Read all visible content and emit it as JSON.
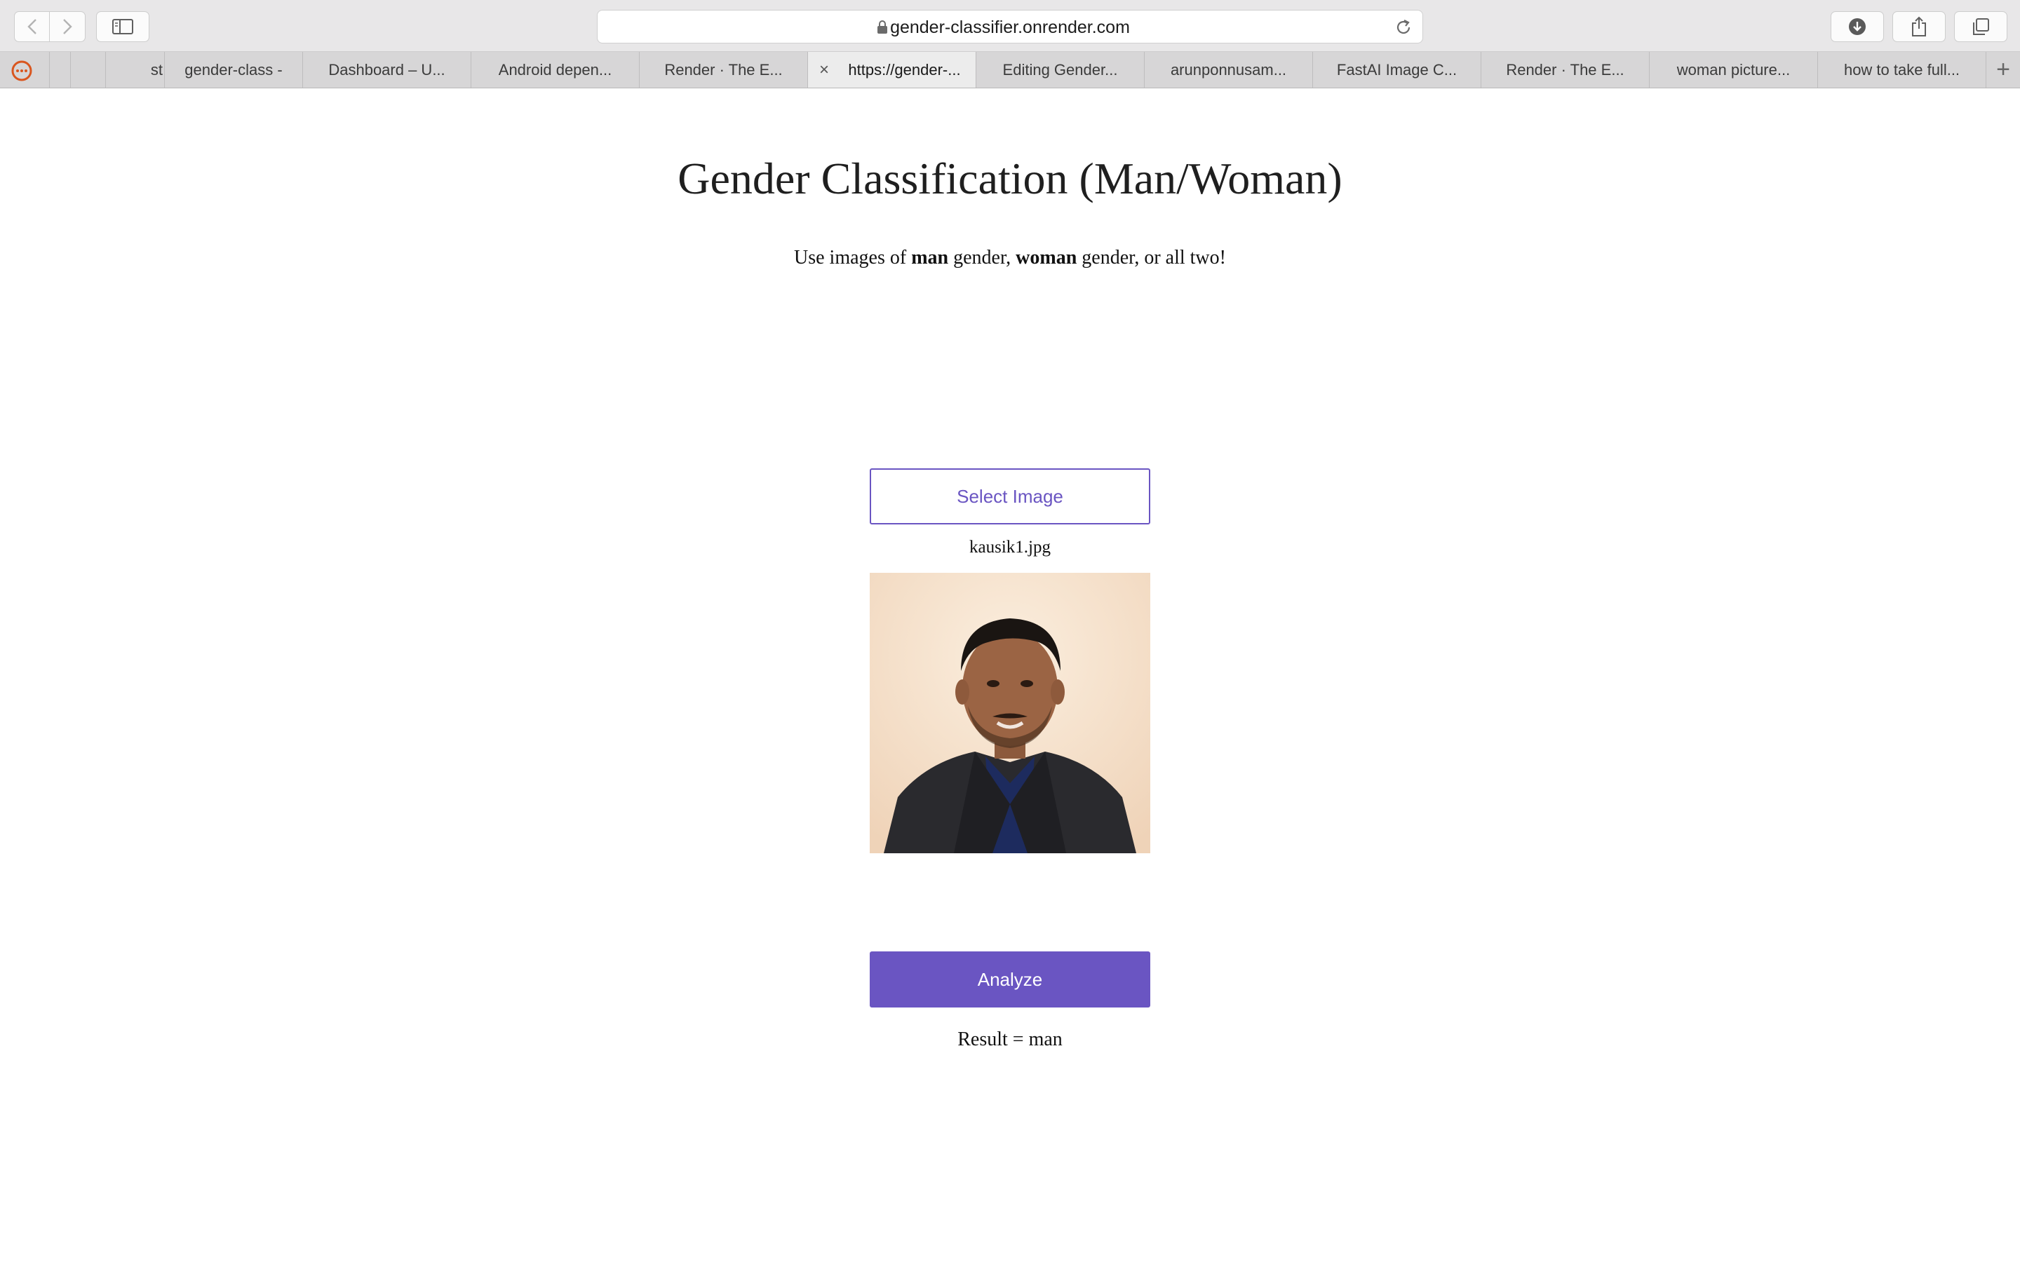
{
  "browser": {
    "url": "gender-classifier.onrender.com",
    "tabs": [
      {
        "label": "st"
      },
      {
        "label": "gender-class -"
      },
      {
        "label": "Dashboard – U..."
      },
      {
        "label": "Android depen..."
      },
      {
        "label": "Render · The E..."
      },
      {
        "label": "https://gender-...",
        "active": true
      },
      {
        "label": "Editing Gender..."
      },
      {
        "label": "arunponnusam..."
      },
      {
        "label": "FastAI Image C..."
      },
      {
        "label": "Render · The E..."
      },
      {
        "label": "woman picture..."
      },
      {
        "label": "how to take full..."
      }
    ],
    "close_tab_glyph": "×",
    "new_tab_glyph": "+"
  },
  "page": {
    "title": "Gender Classification (Man/Woman)",
    "subtitle": {
      "prefix": "Use images of ",
      "bold1": "man",
      "middle": " gender, ",
      "bold2": "woman",
      "suffix": " gender, or all two!"
    },
    "select_button": "Select Image",
    "filename": "kausik1.jpg",
    "analyze_button": "Analyze",
    "result": "Result = man"
  },
  "colors": {
    "accent": "#6a55c2"
  },
  "icons": [
    "back-icon",
    "forward-icon",
    "sidebar-icon",
    "lock-icon",
    "reload-icon",
    "download-icon",
    "share-icon",
    "tabs-overview-icon",
    "favicon-icon",
    "close-icon",
    "add-tab-icon"
  ]
}
